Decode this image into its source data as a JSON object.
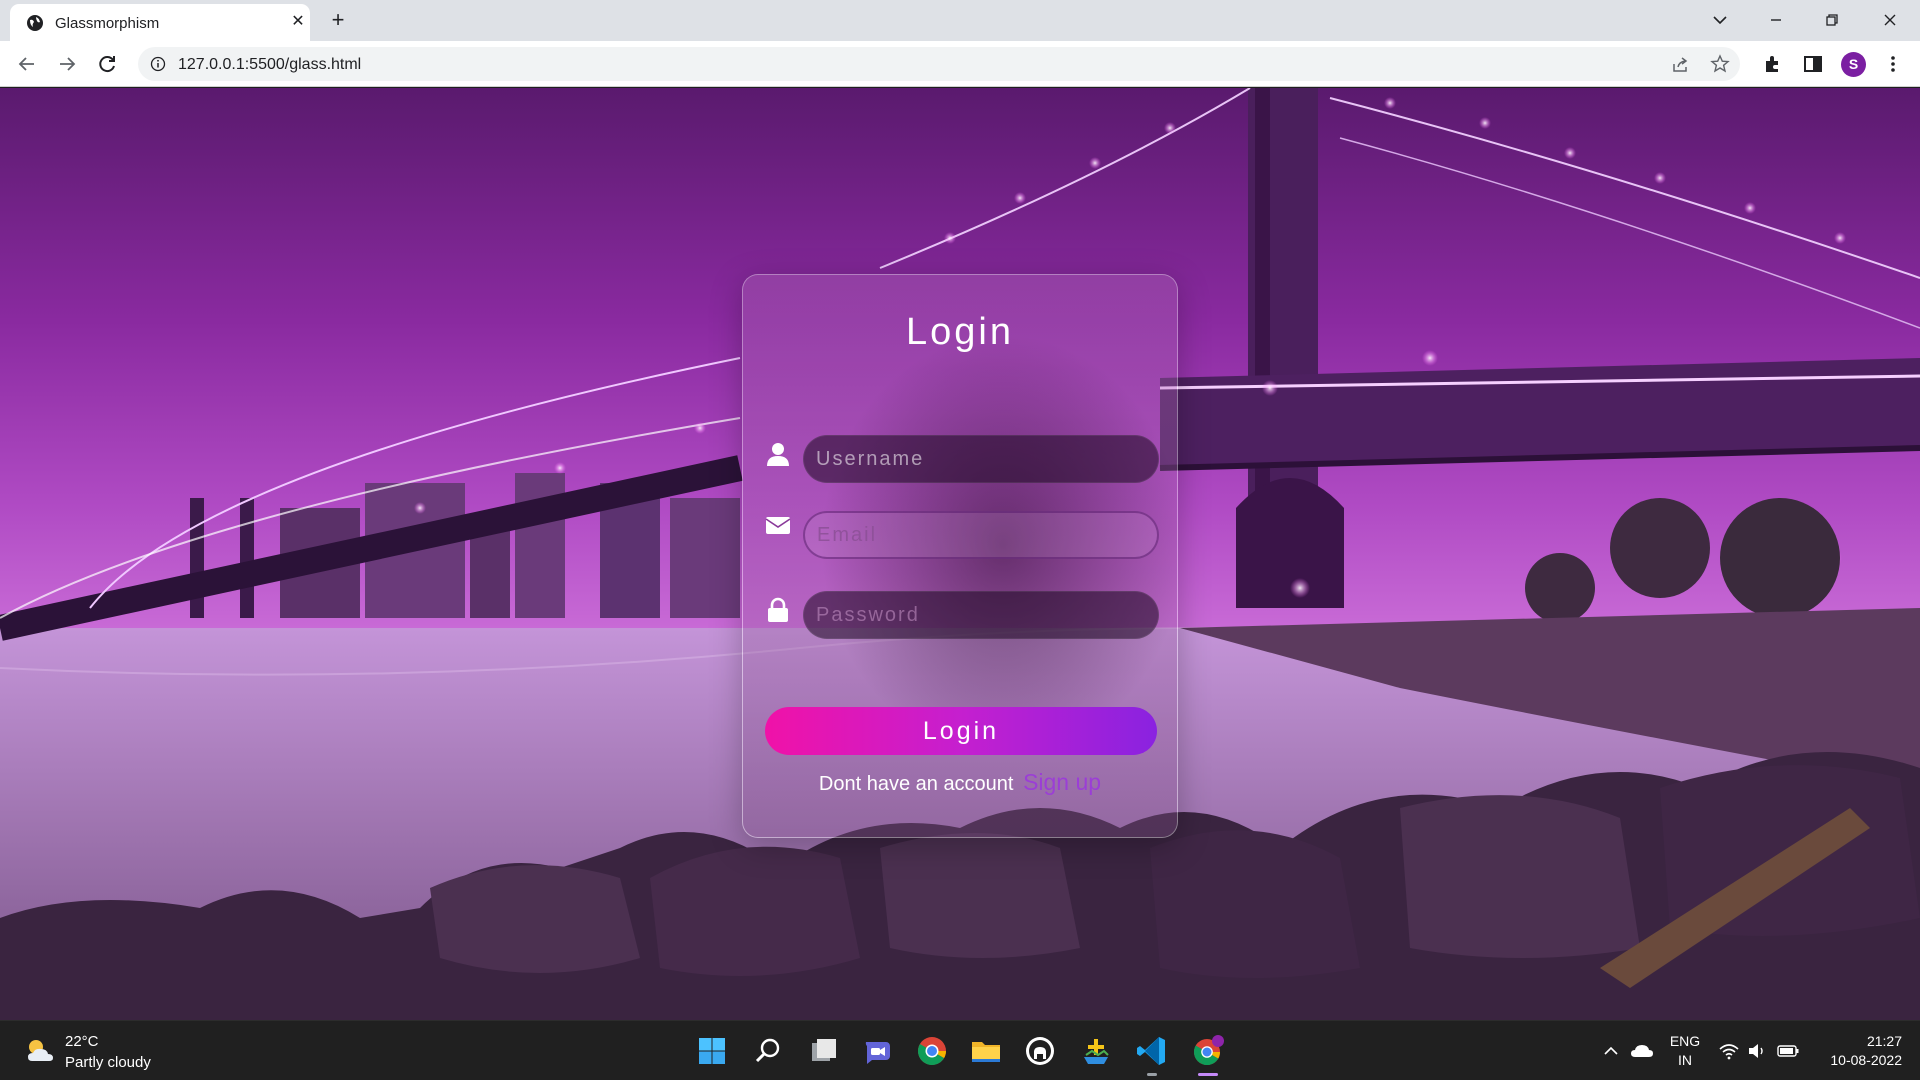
{
  "browser": {
    "tab_title": "Glassmorphism",
    "tab_close": "✕",
    "new_tab": "+",
    "url": "127.0.0.1:5500/glass.html",
    "profile_initial": "S",
    "window_controls": [
      "chevron-down-icon",
      "minimize-icon",
      "restore-icon",
      "close-icon"
    ]
  },
  "page": {
    "background": "night bridge over river with rocks, purple tint",
    "accent": "#9b3ed6",
    "login_form": {
      "title": "Login",
      "username_placeholder": "Username",
      "email_placeholder": "Email",
      "password_placeholder": "Password",
      "submit_label": "Login",
      "signup_prompt": "Dont have an account",
      "signup_link": "Sign up",
      "icons": [
        "user-icon",
        "envelope-icon",
        "lock-icon"
      ]
    }
  },
  "taskbar": {
    "weather": {
      "temp": "22°C",
      "desc": "Partly cloudy"
    },
    "apps": [
      "start-icon",
      "search-icon",
      "task-view-icon",
      "teams-chat-icon",
      "chrome-icon",
      "file-explorer-icon",
      "github-icon",
      "app-icon",
      "vscode-icon",
      "chrome-profile-icon"
    ],
    "language": {
      "line1": "ENG",
      "line2": "IN"
    },
    "time": "21:27",
    "date": "10-08-2022"
  }
}
